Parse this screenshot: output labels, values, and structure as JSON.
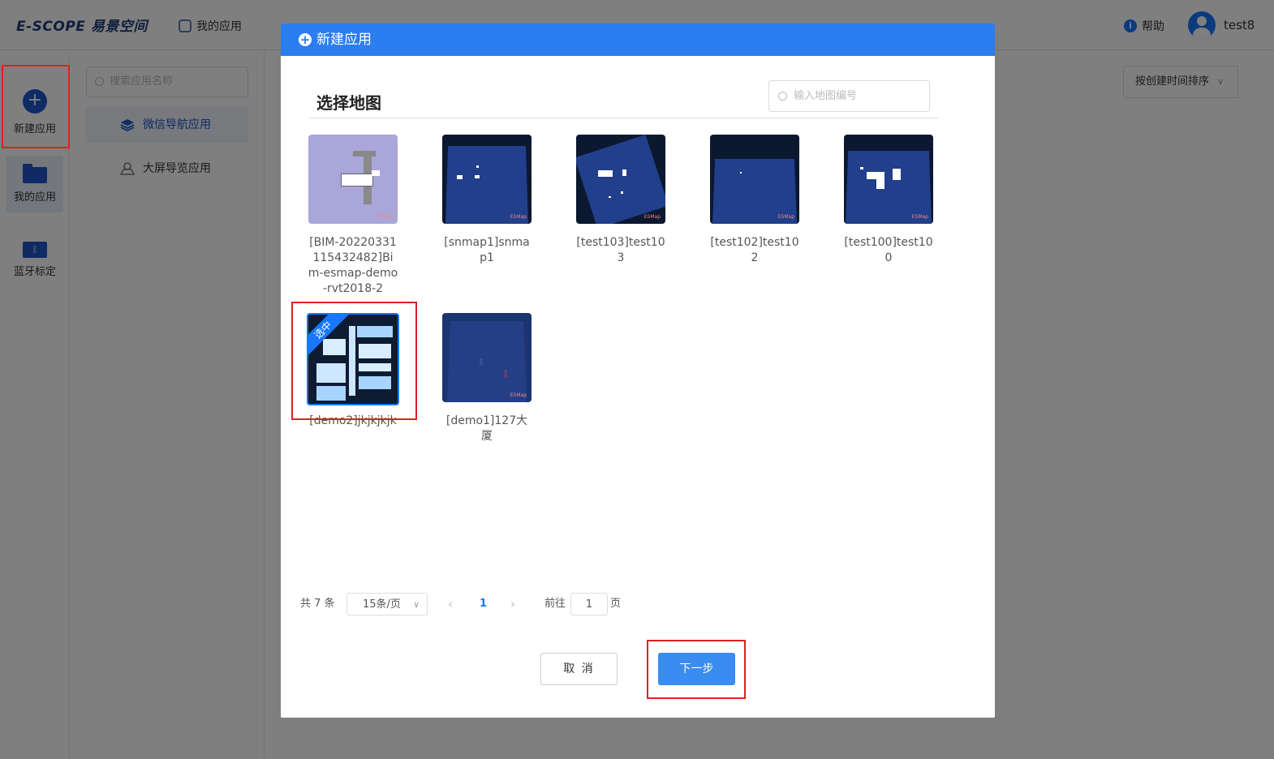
{
  "app": {
    "logo": "E-SCOPE 易景空间",
    "nav_my_apps": "我的应用",
    "help": "帮助",
    "username": "test8"
  },
  "leftbar": {
    "new_app": "新建应用",
    "my_apps": "我的应用",
    "bluetooth": "蓝牙标定"
  },
  "subnav": {
    "search_placeholder": "搜索应用名称",
    "items": [
      {
        "label": "微信导航应用"
      },
      {
        "label": "大屏导览应用"
      }
    ]
  },
  "main": {
    "sort_label": "按创建时间排序"
  },
  "modal": {
    "title": "新建应用",
    "section_title": "选择地图",
    "search_placeholder": "输入地图编号",
    "maps": [
      {
        "label": "[BIM-20220331115432482]Bim-esmap-demo-rvt2018-2",
        "watermark": "ESMap"
      },
      {
        "label": "[snmap1]snmap1",
        "watermark": "ESMap"
      },
      {
        "label": "[test103]test103",
        "watermark": "ESMap"
      },
      {
        "label": "[test102]test102",
        "watermark": "ESMap"
      },
      {
        "label": "[test100]test100",
        "watermark": "ESMap"
      },
      {
        "label": "[demo2]jkjkjkjk",
        "selected_badge": "选中"
      },
      {
        "label": "[demo1]127大厦",
        "watermark": "ESMap"
      }
    ],
    "pagination": {
      "total": "共 7 条",
      "page_size": "15条/页",
      "current_page": "1",
      "goto_label": "前往",
      "goto_value": "1",
      "goto_unit": "页"
    },
    "cancel_label": "取 消",
    "next_label": "下一步"
  }
}
